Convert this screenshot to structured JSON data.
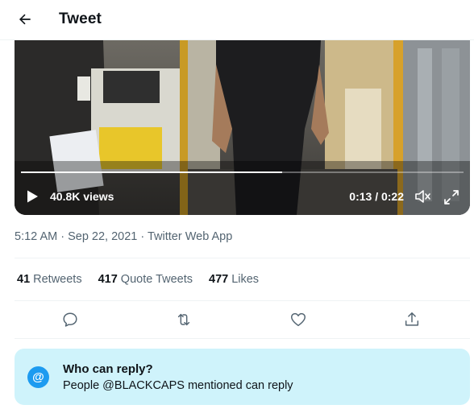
{
  "header": {
    "title": "Tweet",
    "back_icon": "arrow-left-icon"
  },
  "video": {
    "views": "40.8K views",
    "time": "0:13 / 0:22",
    "progress": 0.59,
    "controls": [
      "play-icon",
      "volume-icon",
      "fullscreen-icon"
    ]
  },
  "tweet": {
    "meta": "5:12 AM · Sep 22, 2021 · Twitter Web App"
  },
  "stats": {
    "retweets_count": "41",
    "retweets_label": "Retweets",
    "quotes_count": "417",
    "quotes_label": "Quote Tweets",
    "likes_count": "477",
    "likes_label": "Likes"
  },
  "actions": [
    "reply-icon",
    "retweet-icon",
    "like-icon",
    "share-icon"
  ],
  "reply_restriction": {
    "title": "Who can reply?",
    "subtitle": "People @BLACKCAPS mentioned can reply",
    "icon_glyph": "@"
  },
  "colors": {
    "accent": "#1d9bf0",
    "reply_box_bg": "#cff3fb",
    "secondary_text": "#536471"
  }
}
